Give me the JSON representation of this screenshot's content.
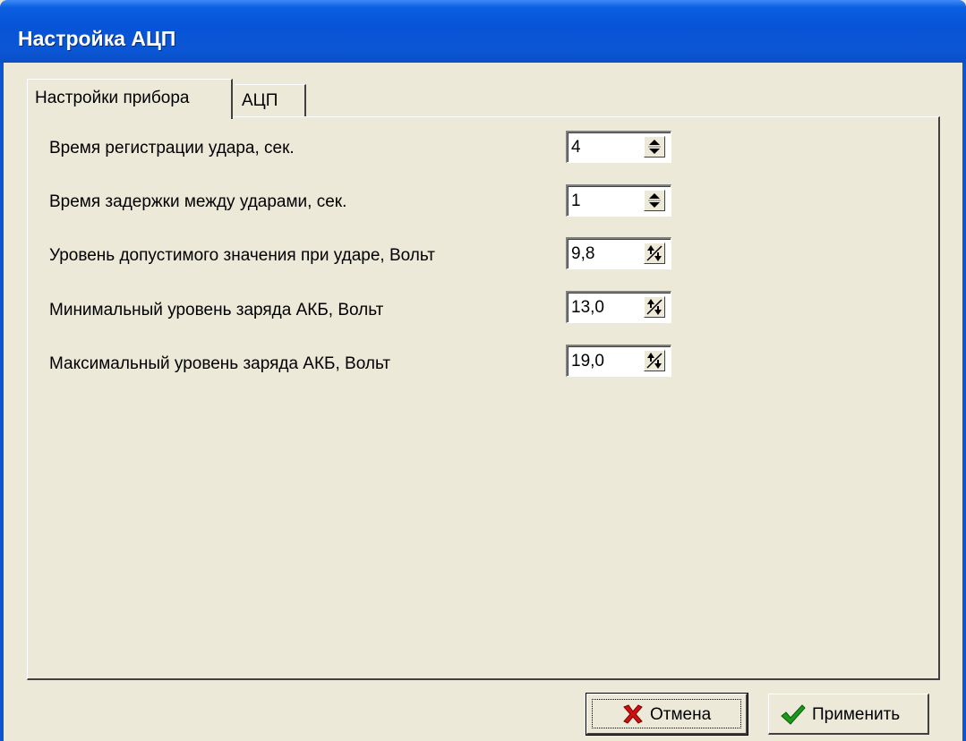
{
  "window": {
    "title": "Настройка АЦП"
  },
  "tabs": [
    {
      "label": "Настройки прибора",
      "active": true
    },
    {
      "label": "АЦП",
      "active": false
    }
  ],
  "settings": [
    {
      "label": "Время регистрации удара, сек.",
      "value": "4",
      "spinner": "updown-arrows-icon"
    },
    {
      "label": "Время задержки между ударами, сек.",
      "value": "1",
      "spinner": "updown-arrows-icon"
    },
    {
      "label": "Уровень допустимого значения при ударе, Вольт",
      "value": "9,8",
      "spinner": "float-spin-icon"
    },
    {
      "label": "Минимальный уровень заряда АКБ, Вольт",
      "value": "13,0",
      "spinner": "float-spin-icon"
    },
    {
      "label": "Максимальный уровень заряда АКБ, Вольт",
      "value": "19,0",
      "spinner": "float-spin-icon"
    }
  ],
  "buttons": {
    "cancel": {
      "label": "Отмена",
      "icon": "red-x-icon",
      "color": "#d01010"
    },
    "apply": {
      "label": "Применить",
      "icon": "green-check-icon",
      "color": "#1a9a1a"
    }
  },
  "colors": {
    "titlebar": "#0a56d4",
    "face": "#ece9d8"
  }
}
